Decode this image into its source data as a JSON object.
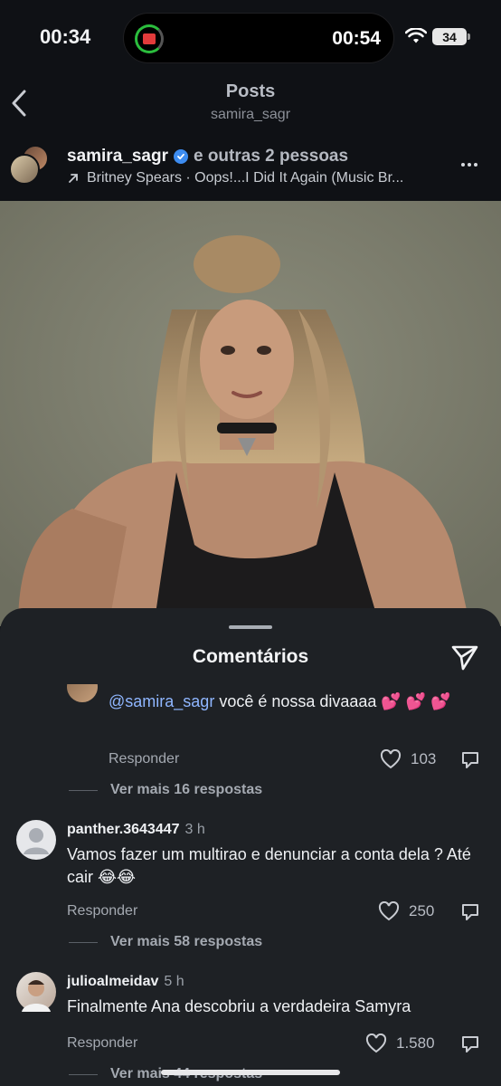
{
  "status_bar": {
    "time": "00:34",
    "island_time": "00:54",
    "battery": "34"
  },
  "nav": {
    "title": "Posts",
    "subtitle": "samira_sagr"
  },
  "post": {
    "username": "samira_sagr",
    "others": "e outras 2 pessoas",
    "music": "Britney Spears · Oops!...I Did It Again (Music Br..."
  },
  "sheet": {
    "title": "Comentários",
    "reply": {
      "mention": "@samira_sagr",
      "text": " você é nossa divaaaa 💕 💕 💕",
      "reply_label": "Responder",
      "likes": "103",
      "view_more": "Ver mais 16 respostas"
    },
    "comments": [
      {
        "username": "panther.3643447",
        "time": "3 h",
        "text": "Vamos fazer um multirao e denunciar a conta dela ? Até cair 😂😂",
        "reply_label": "Responder",
        "likes": "250",
        "view_more": "Ver mais 58 respostas"
      },
      {
        "username": "julioalmeidav",
        "time": "5 h",
        "text": "Finalmente Ana descobriu a verdadeira Samyra",
        "reply_label": "Responder",
        "likes": "1.580",
        "view_more": "Ver mais 44 respostas"
      }
    ]
  },
  "colors": {
    "background": "#0f1115",
    "sheet": "#1e2125",
    "mention": "#8fb6ff",
    "verified": "#3d8cf0"
  },
  "icons": [
    "chevron-left-icon",
    "verified-icon",
    "arrow-up-right-icon",
    "more-icon",
    "send-icon",
    "heart-icon",
    "share-icon",
    "wifi-icon"
  ]
}
